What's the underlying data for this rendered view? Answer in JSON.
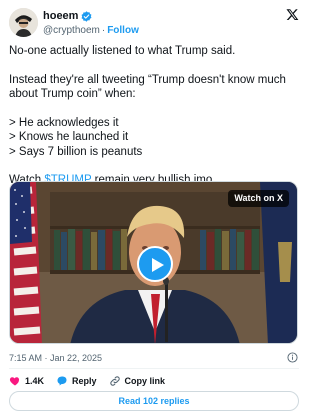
{
  "author": {
    "display_name": "hoeem",
    "handle": "@crypthoem",
    "separator": "·",
    "follow_label": "Follow"
  },
  "tweet": {
    "lines": [
      "No-one actually listened to what Trump said.",
      "Instead they're all tweeting “Trump doesn't know much about Trump coin” when:",
      "> He acknowledges it",
      "> Knows he launched it",
      "> Says 7 billion is peanuts",
      "Watch "
    ],
    "cashtag": "$TRUMP",
    "last_suffix": " remain very bullish imo."
  },
  "media": {
    "badge": "Watch on X"
  },
  "timestamp": "7:15 AM · Jan 22, 2025",
  "actions": {
    "likes": "1.4K",
    "reply_label": "Reply",
    "copy_link_label": "Copy link"
  },
  "read_replies_label": "Read 102 replies",
  "colors": {
    "accent": "#1d9bf0",
    "like": "#f91880",
    "muted": "#536471"
  }
}
